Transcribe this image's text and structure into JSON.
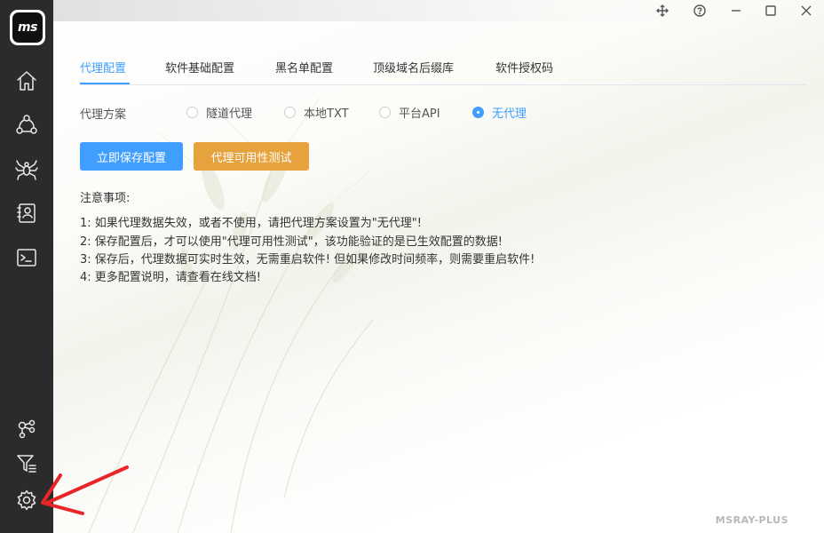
{
  "app": {
    "logo_text": "ms",
    "brand": "MSRAY-PLUS"
  },
  "sidebar": {
    "top_items": [
      {
        "name": "home",
        "icon": "home-icon"
      },
      {
        "name": "share-network",
        "icon": "network-icon"
      },
      {
        "name": "spider",
        "icon": "spider-icon"
      },
      {
        "name": "contacts",
        "icon": "contact-card-icon"
      },
      {
        "name": "terminal",
        "icon": "terminal-icon"
      }
    ],
    "bottom_items": [
      {
        "name": "nodes",
        "icon": "nodes-icon"
      },
      {
        "name": "filter",
        "icon": "filter-list-icon"
      },
      {
        "name": "settings",
        "icon": "gear-icon"
      }
    ]
  },
  "window_controls": [
    "move-icon",
    "help-icon",
    "minimize-icon",
    "maximize-icon",
    "close-icon"
  ],
  "tabs": [
    {
      "label": "代理配置",
      "active": true
    },
    {
      "label": "软件基础配置",
      "active": false
    },
    {
      "label": "黑名单配置",
      "active": false
    },
    {
      "label": "顶级域名后缀库",
      "active": false
    },
    {
      "label": "软件授权码",
      "active": false
    }
  ],
  "proxy": {
    "label": "代理方案",
    "options": [
      {
        "label": "隧道代理",
        "checked": false
      },
      {
        "label": "本地TXT",
        "checked": false
      },
      {
        "label": "平台API",
        "checked": false
      },
      {
        "label": "无代理",
        "checked": true
      }
    ]
  },
  "buttons": {
    "save": "立即保存配置",
    "test": "代理可用性测试"
  },
  "notes": {
    "title": "注意事项:",
    "items": [
      "1: 如果代理数据失效，或者不使用，请把代理方案设置为\"无代理\"!",
      "2: 保存配置后，才可以使用\"代理可用性测试\"，该功能验证的是已生效配置的数据!",
      "3: 保存后，代理数据可实时生效，无需重启软件! 但如果修改时间频率，则需要重启软件!",
      "4: 更多配置说明，请查看在线文档!"
    ]
  },
  "colors": {
    "accent": "#409eff",
    "warning": "#e6a23c",
    "sidebar_bg": "#2b2b2b",
    "annotation": "#e8262a"
  }
}
